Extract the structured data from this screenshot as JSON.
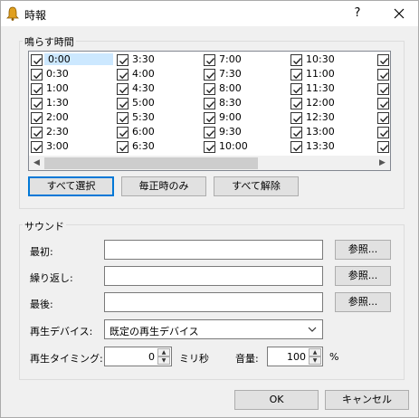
{
  "window": {
    "title": "時報",
    "help_label": "?"
  },
  "times_group": {
    "label": "鳴らす時間",
    "columns": [
      [
        "0:00",
        "0:30",
        "1:00",
        "1:30",
        "2:00",
        "2:30",
        "3:00"
      ],
      [
        "3:30",
        "4:00",
        "4:30",
        "5:00",
        "5:30",
        "6:00",
        "6:30"
      ],
      [
        "7:00",
        "7:30",
        "8:00",
        "8:30",
        "9:00",
        "9:30",
        "10:00"
      ],
      [
        "10:30",
        "11:00",
        "11:30",
        "12:00",
        "12:30",
        "13:00",
        "13:30"
      ],
      [
        "",
        "",
        "",
        "",
        "",
        "",
        ""
      ]
    ],
    "selected": "0:00",
    "buttons": {
      "select_all": "すべて選択",
      "hourly_only": "毎正時のみ",
      "clear_all": "すべて解除"
    }
  },
  "sound_group": {
    "label": "サウンド",
    "first_label": "最初:",
    "repeat_label": "繰り返し:",
    "last_label": "最後:",
    "first_value": "",
    "repeat_value": "",
    "last_value": "",
    "browse_label": "参照...",
    "device_label": "再生デバイス:",
    "device_value": "既定の再生デバイス",
    "timing_label": "再生タイミング:",
    "timing_value": "0",
    "timing_unit": "ミリ秒",
    "volume_label": "音量:",
    "volume_value": "100",
    "volume_unit": "%"
  },
  "footer": {
    "ok_label": "OK",
    "cancel_label": "キャンセル"
  }
}
